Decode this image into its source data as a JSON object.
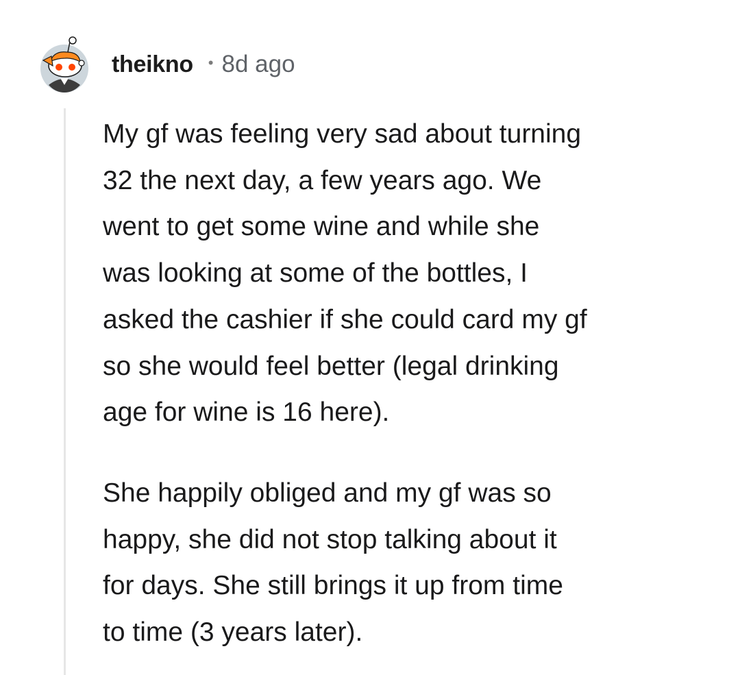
{
  "comment": {
    "author": "theikno",
    "separator": "•",
    "timestamp": "8d ago",
    "avatar_icon": "snoo-avatar-icon",
    "colors": {
      "username": "#1c1c1c",
      "timestamp": "#5f6368",
      "thread_line": "#e6e6e6",
      "avatar_bg": "#cdd6dc",
      "avatar_accent": "#ff4500"
    },
    "paragraphs": [
      "My gf was feeling very sad about turning\n32 the next day, a few years ago. We\nwent to get some wine and while she\nwas looking at some of the bottles, I\nasked the cashier if she could card my gf\nso she would feel better (legal drinking\nage for wine is 16 here).",
      "She happily obliged and my gf was so\nhappy, she did not stop talking about it\nfor days. She still brings it up from time\nto time (3 years later)."
    ]
  }
}
